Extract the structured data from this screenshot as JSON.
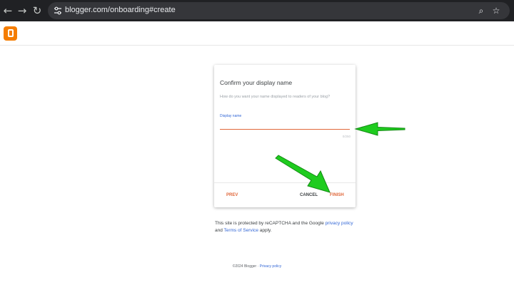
{
  "browser": {
    "back_icon": "←",
    "forward_icon": "→",
    "reload_icon": "↻",
    "url": "blogger.com/onboarding#create",
    "zoom_icon": "⌕",
    "star_icon": "☆"
  },
  "dialog": {
    "title": "Confirm your display name",
    "subtitle": "How do you want your name displayed to readers of your blog?",
    "field_label": "Display name",
    "field_value": "",
    "counter": "0/250",
    "prev_label": "PREV",
    "cancel_label": "CANCEL",
    "finish_label": "FINISH"
  },
  "recaptcha": {
    "text_before": "This site is protected by reCAPTCHA and the Google ",
    "privacy_label": "privacy policy",
    "and_text": " and ",
    "terms_label": "Terms of Service",
    "text_after": " apply."
  },
  "footer": {
    "copyright": "©2024 Blogger · ",
    "privacy_label": "Privacy policy"
  },
  "colors": {
    "accent": "#e0683b",
    "link": "#3367d6",
    "arrow": "#1fcc1f",
    "logo": "#f57d00"
  }
}
